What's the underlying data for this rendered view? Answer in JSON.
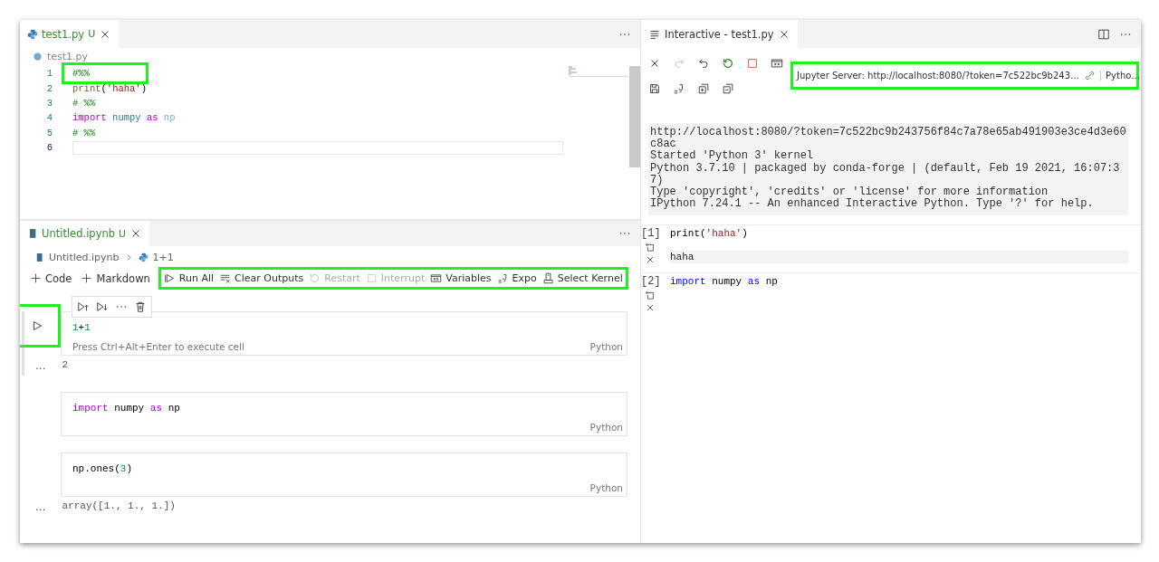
{
  "editor": {
    "tab": {
      "label": "test1.py",
      "badge": "U",
      "selected": true
    },
    "breadcrumb": "test1.py",
    "lines": [
      {
        "number": "1",
        "highlighted": true,
        "current": false,
        "tokens": [
          {
            "text": "#%%",
            "kind": "comment"
          }
        ]
      },
      {
        "number": "2",
        "highlighted": false,
        "current": false,
        "tokens": [
          {
            "text": "print",
            "kind": "function"
          },
          {
            "text": "(",
            "kind": "plain"
          },
          {
            "text": "'haha'",
            "kind": "string"
          },
          {
            "text": ")",
            "kind": "plain"
          }
        ]
      },
      {
        "number": "3",
        "highlighted": false,
        "current": false,
        "tokens": [
          {
            "text": "# %%",
            "kind": "comment"
          }
        ]
      },
      {
        "number": "4",
        "highlighted": false,
        "current": false,
        "tokens": [
          {
            "text": "import",
            "kind": "keyword"
          },
          {
            "text": " numpy ",
            "kind": "module"
          },
          {
            "text": "as",
            "kind": "keyword"
          },
          {
            "text": " np",
            "kind": "variable"
          }
        ]
      },
      {
        "number": "5",
        "highlighted": false,
        "current": false,
        "tokens": [
          {
            "text": "# %%",
            "kind": "comment"
          }
        ]
      },
      {
        "number": "6",
        "highlighted": false,
        "current": true
      }
    ]
  },
  "notebook": {
    "tab": {
      "label": "Untitled.ipynb",
      "badge": "U",
      "selected": true
    },
    "breadcrumb": [
      {
        "label": "Untitled.ipynb",
        "kind": "notebook"
      },
      {
        "label": "1+1",
        "kind": "python"
      }
    ],
    "add_buttons": [
      {
        "label": "Code"
      },
      {
        "label": "Markdown"
      }
    ],
    "toolbar": {
      "highlighted": true,
      "items": [
        {
          "label": "Run All",
          "kind": "run-all",
          "disabled": false
        },
        {
          "label": "Clear Outputs",
          "kind": "clear",
          "disabled": false
        },
        {
          "label": "Restart",
          "kind": "restart",
          "disabled": true
        },
        {
          "label": "Interrupt",
          "kind": "interrupt",
          "disabled": true
        },
        {
          "label": "Variables",
          "kind": "variables",
          "disabled": false
        },
        {
          "label": "Expo",
          "kind": "export",
          "disabled": false
        },
        {
          "label": "Select Kernel",
          "kind": "kernel",
          "disabled": false
        }
      ]
    },
    "run_button_highlighted": true,
    "cells": [
      {
        "selected": true,
        "code": [
          {
            "text": "1",
            "kind": "number"
          },
          {
            "text": "+",
            "kind": "plain"
          },
          {
            "text": "1",
            "kind": "number"
          }
        ],
        "hint": "Press Ctrl+Alt+Enter to execute cell",
        "language": "Python",
        "output_prompt": "…",
        "output": "2"
      },
      {
        "selected": false,
        "code": [
          {
            "text": "import",
            "kind": "keyword"
          },
          {
            "text": " numpy ",
            "kind": "plain"
          },
          {
            "text": "as",
            "kind": "keyword"
          },
          {
            "text": " np",
            "kind": "plain"
          }
        ],
        "language": "Python"
      },
      {
        "selected": false,
        "code": [
          {
            "text": "np.ones(",
            "kind": "plain"
          },
          {
            "text": "3",
            "kind": "number"
          },
          {
            "text": ")",
            "kind": "plain"
          }
        ],
        "language": "Python",
        "output_prompt": "…",
        "output": "array([1., 1., 1.])"
      }
    ]
  },
  "interactive": {
    "tab": {
      "label": "Interactive - test1.py",
      "selected": true
    },
    "toolbar_rows": [
      [
        {
          "kind": "close",
          "disabled": false
        },
        {
          "kind": "redo",
          "disabled": true
        },
        {
          "kind": "undo",
          "disabled": false
        },
        {
          "kind": "restart",
          "disabled": false
        },
        {
          "kind": "interrupt",
          "disabled": false
        },
        {
          "kind": "variables",
          "disabled": false
        }
      ],
      [
        {
          "kind": "save",
          "disabled": false
        },
        {
          "kind": "export",
          "disabled": false
        },
        {
          "kind": "expand",
          "disabled": false
        },
        {
          "kind": "collapse",
          "disabled": false
        }
      ]
    ],
    "server": {
      "label": "Jupyter Server: http://localhost:8080/?token=7c522bc9b243…",
      "kernel": "Pytho…",
      "highlighted": true
    },
    "banner": [
      "http://localhost:8080/?token=7c522bc9b243756f84c7a78e65ab491903e3ce4d3e60",
      "c8ac",
      "Started 'Python 3' kernel",
      "Python 3.7.10 | packaged by conda-forge | (default, Feb 19 2021, 16:07:3",
      "7)",
      "Type 'copyright', 'credits' or 'license' for more information",
      "IPython 7.24.1 -- An enhanced Interactive Python. Type '?' for help."
    ],
    "cells": [
      {
        "prompt": "[1]",
        "code": [
          {
            "text": "print(",
            "kind": "plain"
          },
          {
            "text": "'haha'",
            "kind": "string"
          },
          {
            "text": ")",
            "kind": "plain"
          }
        ],
        "output": "haha"
      },
      {
        "prompt": "[2]",
        "code": [
          {
            "text": "import",
            "kind": "keyword"
          },
          {
            "text": " numpy ",
            "kind": "plain"
          },
          {
            "text": "as",
            "kind": "keyword"
          },
          {
            "text": " np",
            "kind": "plain"
          }
        ]
      }
    ]
  }
}
